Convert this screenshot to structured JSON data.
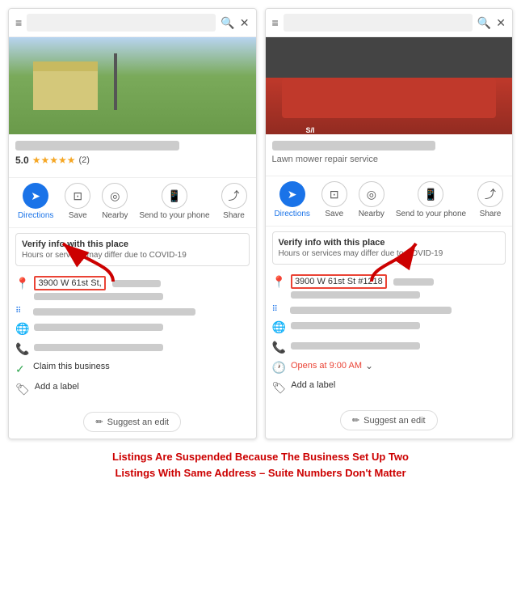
{
  "panels": [
    {
      "id": "left",
      "photo_class": "left",
      "rating": "5.0",
      "stars": "★★★★★",
      "reviews": "(2)",
      "category": "",
      "actions": [
        {
          "label": "Directions",
          "icon": "➤"
        },
        {
          "label": "Save",
          "icon": "🔖"
        },
        {
          "label": "Nearby",
          "icon": "◎"
        },
        {
          "label": "Send to your phone",
          "icon": "📱"
        },
        {
          "label": "Share",
          "icon": "↗"
        }
      ],
      "verify_title": "Verify info with this place",
      "verify_sub": "Hours or services may differ due to COVID-19",
      "address_highlight": "3900 W 61st St,",
      "suggest_label": "Suggest an edit",
      "bottom_items": [
        {
          "type": "address"
        },
        {
          "type": "dots"
        },
        {
          "type": "globe"
        },
        {
          "type": "phone"
        },
        {
          "type": "claim"
        },
        {
          "type": "label"
        }
      ]
    },
    {
      "id": "right",
      "photo_class": "right",
      "rating": "",
      "stars": "",
      "reviews": "",
      "category": "Lawn mower repair service",
      "actions": [
        {
          "label": "Directions",
          "icon": "➤"
        },
        {
          "label": "Save",
          "icon": "🔖"
        },
        {
          "label": "Nearby",
          "icon": "◎"
        },
        {
          "label": "Send to your phone",
          "icon": "📱"
        },
        {
          "label": "Share",
          "icon": "↗"
        }
      ],
      "verify_title": "Verify info with this place",
      "verify_sub": "Hours or services may differ due to COVID-19",
      "address_highlight": "3900 W 61st St #1218",
      "suggest_label": "Suggest an edit",
      "opens_text": "Opens at 9:00 AM",
      "bottom_items": [
        {
          "type": "address"
        },
        {
          "type": "dots"
        },
        {
          "type": "globe"
        },
        {
          "type": "phone"
        },
        {
          "type": "opens"
        },
        {
          "type": "label"
        }
      ]
    }
  ],
  "caption": "Listings Are Suspended Because The Business Set Up Two\nListings With Same Address – Suite Numbers Don't Matter",
  "icons": {
    "hamburger": "≡",
    "search": "🔍",
    "close": "✕",
    "directions": "➤",
    "save": "⊡",
    "nearby": "◎",
    "phone_send": "📱",
    "share": "⤴",
    "pin": "📍",
    "dots_grid": "⋮⋮",
    "globe": "🌐",
    "phone": "📞",
    "checkmark": "✓",
    "tag": "🏷",
    "pencil": "✏",
    "chevron": "⌄",
    "clock": "🕐"
  }
}
